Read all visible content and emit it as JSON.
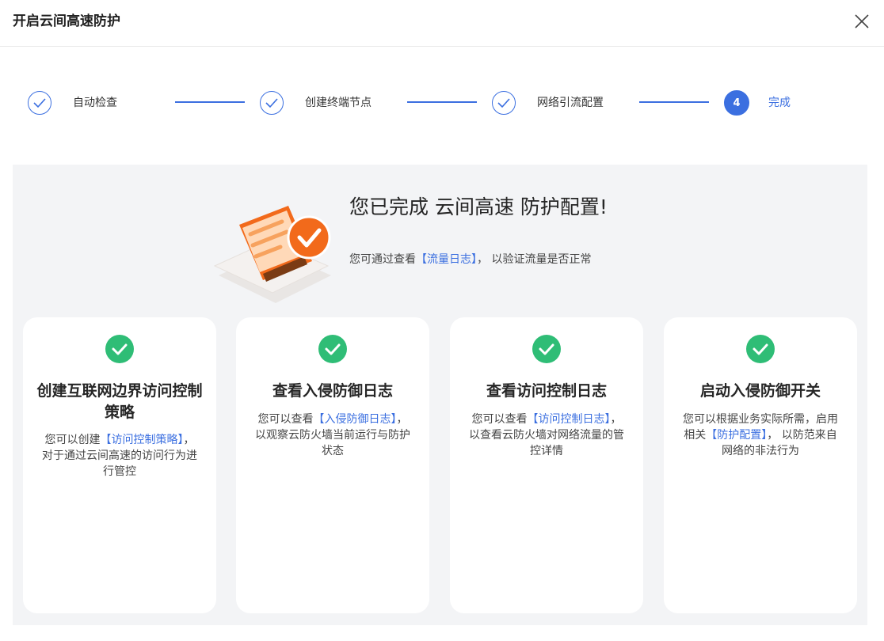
{
  "header": {
    "title": "开启云间高速防护"
  },
  "steps": [
    {
      "label": "自动检查",
      "state": "done"
    },
    {
      "label": "创建终端节点",
      "state": "done"
    },
    {
      "label": "网络引流配置",
      "state": "done"
    },
    {
      "label": "完成",
      "number": "4",
      "state": "active"
    }
  ],
  "colors": {
    "accent": "#3b6fe0",
    "success": "#2fbd76",
    "orange": "#f26a1b",
    "panel": "#f3f4f6"
  },
  "result": {
    "title": "您已完成 云间高速 防护配置!",
    "subtitle_before": "您可通过查看",
    "subtitle_link": "【流量日志】",
    "subtitle_after": "， 以验证流量是否正常"
  },
  "cards": [
    {
      "title": "创建互联网边界访问控制策略",
      "desc_before": "您可以创建",
      "link": "【访问控制策略】",
      "desc_after": "， 对于通过云间高速的访问行为进行管控"
    },
    {
      "title": "查看入侵防御日志",
      "desc_before": "您可以查看",
      "link": "【入侵防御日志】",
      "desc_after": "， 以观察云防火墙当前运行与防护状态"
    },
    {
      "title": "查看访问控制日志",
      "desc_before": "您可以查看",
      "link": "【访问控制日志】",
      "desc_after": "， 以查看云防火墙对网络流量的管控详情"
    },
    {
      "title": "启动入侵防御开关",
      "desc_before": "您可以根据业务实际所需，启用相关",
      "link": "【防护配置】",
      "desc_after": "， 以防范来自网络的非法行为"
    }
  ]
}
